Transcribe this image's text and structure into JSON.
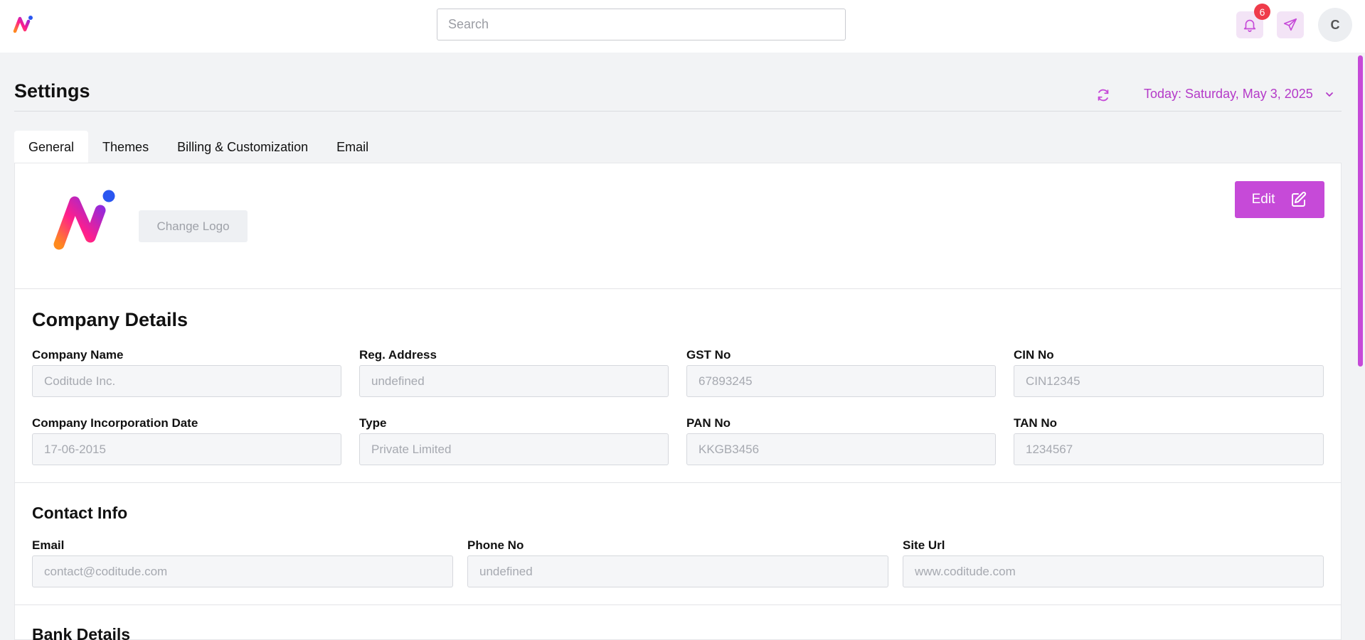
{
  "topbar": {
    "search_placeholder": "Search",
    "notification_count": "6",
    "avatar_initial": "C"
  },
  "header": {
    "title": "Settings",
    "date_label": "Today: Saturday, May 3, 2025"
  },
  "tabs": [
    {
      "label": "General",
      "active": true
    },
    {
      "label": "Themes",
      "active": false
    },
    {
      "label": "Billing & Customization",
      "active": false
    },
    {
      "label": "Email",
      "active": false
    }
  ],
  "logo_section": {
    "change_logo_label": "Change Logo",
    "edit_label": "Edit"
  },
  "company": {
    "title": "Company Details",
    "fields": [
      {
        "label": "Company Name",
        "value": "Coditude Inc."
      },
      {
        "label": "Reg. Address",
        "value": "undefined"
      },
      {
        "label": "GST No",
        "value": "67893245"
      },
      {
        "label": "CIN No",
        "value": "CIN12345"
      },
      {
        "label": "Company Incorporation Date",
        "value": "17-06-2015"
      },
      {
        "label": "Type",
        "value": "Private Limited"
      },
      {
        "label": "PAN No",
        "value": "KKGB3456"
      },
      {
        "label": "TAN No",
        "value": "1234567"
      }
    ]
  },
  "contact": {
    "title": "Contact Info",
    "fields": [
      {
        "label": "Email",
        "value": "contact@coditude.com"
      },
      {
        "label": "Phone No",
        "value": "undefined"
      },
      {
        "label": "Site Url",
        "value": "www.coditude.com"
      }
    ]
  },
  "bank": {
    "title": "Bank Details"
  },
  "colors": {
    "accent": "#c64ad8",
    "accent_text": "#b43ac8",
    "badge": "#ef3b4a",
    "page_bg": "#f2f3f5"
  },
  "icons": [
    "app-logo-icon",
    "bell-icon",
    "send-icon",
    "refresh-icon",
    "chevron-down-icon",
    "edit-icon"
  ]
}
